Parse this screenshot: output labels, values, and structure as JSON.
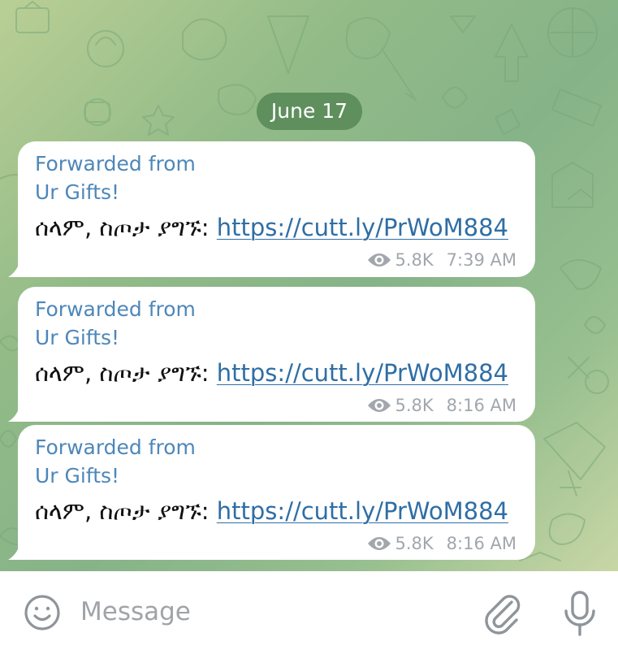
{
  "chat": {
    "date_label": "June 17",
    "messages": [
      {
        "forwarded_line1": "Forwarded from",
        "forwarded_line2": "Ur Gifts!",
        "text": "ሰላም, ስጦታ ያግኙ: ",
        "link": "https://cutt.ly/PrWoM884",
        "views": "5.8K",
        "time": "7:39 AM"
      },
      {
        "forwarded_line1": "Forwarded from",
        "forwarded_line2": "Ur Gifts!",
        "text": "ሰላም, ስጦታ ያግኙ: ",
        "link": "https://cutt.ly/PrWoM884",
        "views": "5.8K",
        "time": "8:16 AM"
      },
      {
        "forwarded_line1": "Forwarded from",
        "forwarded_line2": "Ur Gifts!",
        "text": "ሰላም, ስጦታ ያግኙ: ",
        "link": "https://cutt.ly/PrWoM884",
        "views": "5.8K",
        "time": "8:16 AM"
      }
    ]
  },
  "composer": {
    "placeholder": "Message",
    "emoji_icon": "smile-icon",
    "attach_icon": "paperclip-icon",
    "mic_icon": "microphone-icon"
  },
  "colors": {
    "date_pill": "#5e8f5d",
    "forward_header": "#4e87b9",
    "link": "#2f6ea5",
    "meta": "#a2a7ad",
    "icons": "#8e959b"
  }
}
